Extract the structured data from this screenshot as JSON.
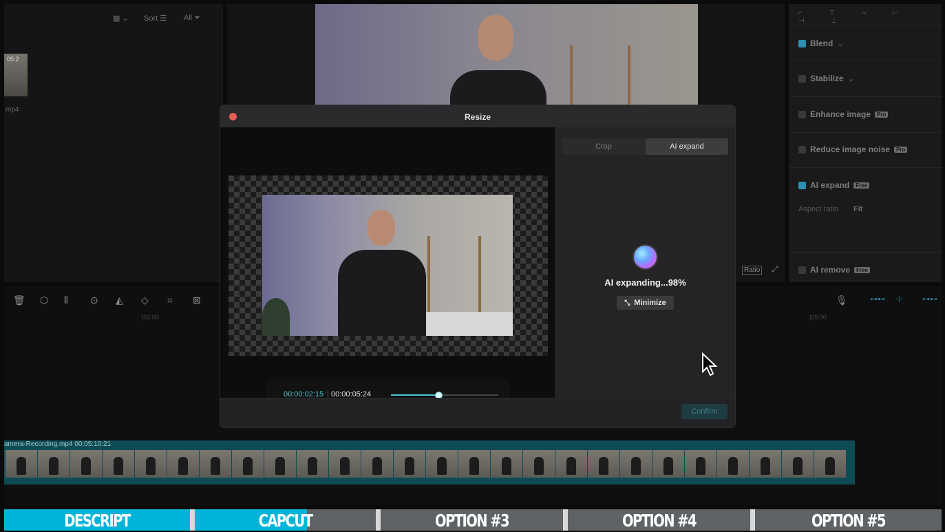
{
  "media": {
    "toolbar": {
      "sort_label": "Sort",
      "all_label": "All"
    },
    "thumb_time": "05:2",
    "thumb_name": "mp4"
  },
  "properties": {
    "blend": "Blend",
    "stabilize": "Stabilize",
    "enhance_image": "Enhance image",
    "reduce_noise": "Reduce image noise",
    "ai_expand": "AI expand",
    "aspect_ratio_label": "Aspect ratio",
    "aspect_ratio_value": "Fit",
    "ai_remove": "AI remove",
    "pro_badge": "Pro",
    "free_badge": "Free"
  },
  "preview": {
    "ratio_label": "Ratio"
  },
  "timeline": {
    "marker_1": "|01:00",
    "marker_2": "|05:00",
    "clip_label": "amera-Recording.mp4  00:05:10:21"
  },
  "modal": {
    "title": "Resize",
    "tabs": [
      "Crop",
      "AI expand"
    ],
    "active_tab": "AI expand",
    "current_time": "00:00:02:15",
    "total_time": "00:00:05:24",
    "playback_progress": 0.44,
    "status": "AI expanding...98%",
    "minimize_label": "Minimize",
    "confirm_label": "Confirm"
  },
  "option_bar": {
    "items": [
      "DESCRIPT",
      "CAPCUT",
      "OPTION #3",
      "OPTION #4",
      "OPTION #5"
    ],
    "colors": {
      "active": "#00b4d8",
      "inactive": "#5f6366",
      "separator": "#d9d9d9"
    }
  }
}
